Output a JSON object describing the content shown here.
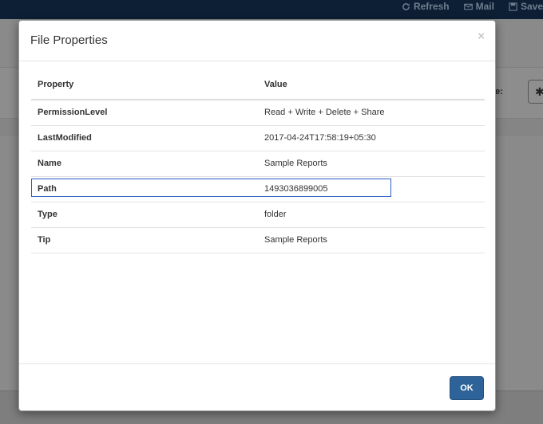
{
  "topbar": {
    "refresh_label": "Refresh",
    "mail_label": "Mail",
    "save_label": "Save"
  },
  "background": {
    "partial_label": "e:",
    "partial_button_glyph": "✱"
  },
  "modal": {
    "title": "File Properties",
    "close_glyph": "×",
    "ok_label": "OK",
    "columns": [
      "Property",
      "Value"
    ],
    "rows": [
      {
        "property": "PermissionLevel",
        "value": "Read + Write + Delete + Share"
      },
      {
        "property": "LastModified",
        "value": "2017-04-24T17:58:19+05:30"
      },
      {
        "property": "Name",
        "value": "Sample Reports"
      },
      {
        "property": "Path",
        "value": "1493036899005"
      },
      {
        "property": "Type",
        "value": "folder"
      },
      {
        "property": "Tip",
        "value": "Sample Reports"
      }
    ],
    "selected_row_index": 3
  }
}
